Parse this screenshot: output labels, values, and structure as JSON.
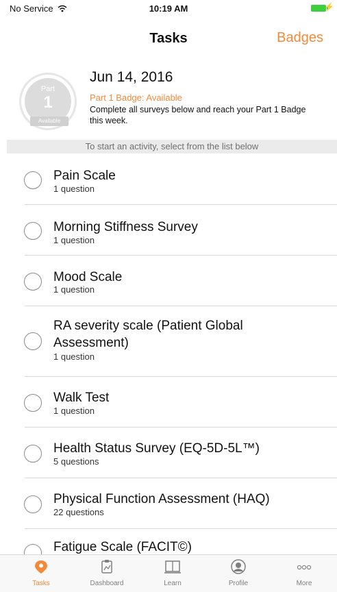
{
  "status_bar": {
    "carrier": "No Service",
    "time": "10:19 AM"
  },
  "nav": {
    "title": "Tasks",
    "right_button": "Badges"
  },
  "badge": {
    "part_label": "Part",
    "part_number": "1",
    "ribbon": "Available",
    "date": "Jun 14, 2016",
    "status": "Part 1 Badge: Available",
    "description": "Complete all surveys below and reach your Part 1 Badge this week."
  },
  "instruction": "To start an activity, select from the list below",
  "tasks": [
    {
      "title": "Pain Scale",
      "subtitle": "1 question"
    },
    {
      "title": "Morning Stiffness Survey",
      "subtitle": "1 question"
    },
    {
      "title": "Mood Scale",
      "subtitle": "1 question"
    },
    {
      "title": "RA severity scale (Patient Global Assessment)",
      "subtitle": "1 question"
    },
    {
      "title": "Walk Test",
      "subtitle": "1 question"
    },
    {
      "title": "Health Status Survey (EQ-5D-5L™)",
      "subtitle": "5 questions"
    },
    {
      "title": "Physical Function Assessment (HAQ)",
      "subtitle": "22 questions"
    },
    {
      "title": "Fatigue Scale (FACIT©)",
      "subtitle": ""
    }
  ],
  "tab_bar": {
    "tasks": "Tasks",
    "dashboard": "Dashboard",
    "learn": "Learn",
    "profile": "Profile",
    "more": "More"
  },
  "colors": {
    "accent": "#f28a3a",
    "battery": "#3ecf3e"
  }
}
